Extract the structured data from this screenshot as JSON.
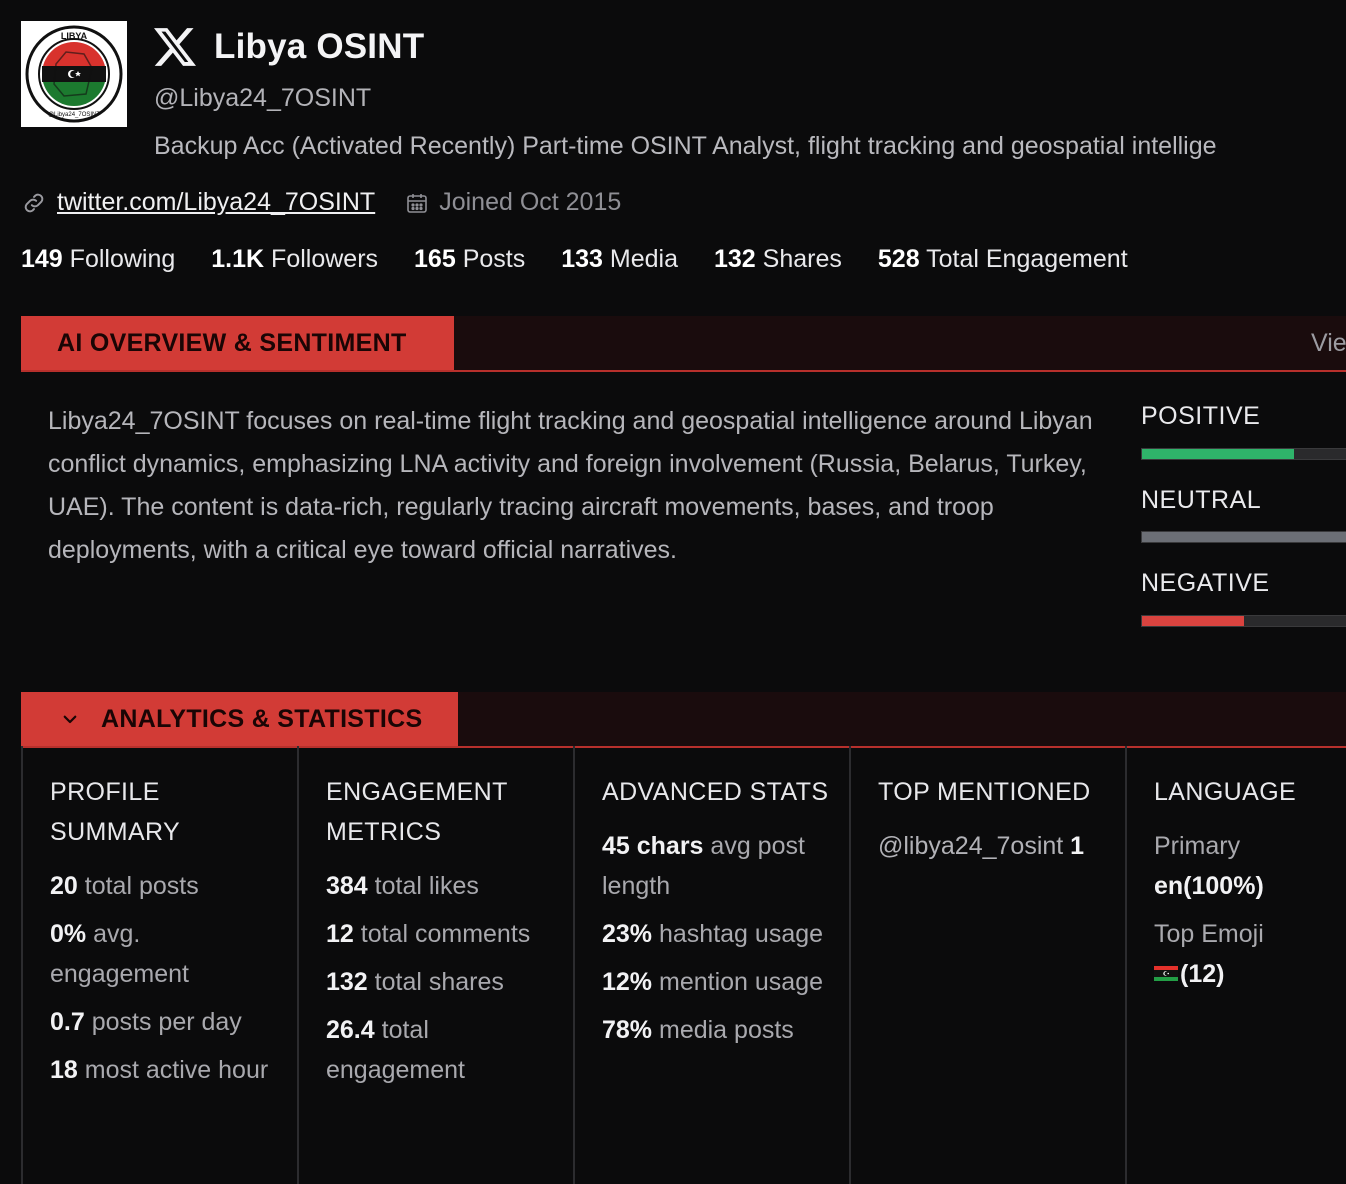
{
  "profile": {
    "name": "Libya OSINT",
    "handle": "@Libya24_7OSINT",
    "bio": "Backup Acc (Activated Recently) Part-time OSINT Analyst, flight tracking and geospatial intellige",
    "link": "twitter.com/Libya24_7OSINT",
    "joined": "Joined Oct 2015",
    "avatar_icon": "libya-osint-logo-icon",
    "avatar_text_top": "LIBYA",
    "avatar_text_bottom": "@Libya24_7OSINT"
  },
  "stats": [
    {
      "value": "149",
      "label": "Following"
    },
    {
      "value": "1.1K",
      "label": "Followers"
    },
    {
      "value": "165",
      "label": "Posts"
    },
    {
      "value": "133",
      "label": "Media"
    },
    {
      "value": "132",
      "label": "Shares"
    },
    {
      "value": "528",
      "label": "Total Engagement"
    }
  ],
  "overview": {
    "tab_label": "AI OVERVIEW & SENTIMENT",
    "view_label": "Vie",
    "text": "Libya24_7OSINT focuses on real-time flight tracking and geospatial intelligence around Libyan conflict dynamics, emphasizing LNA activity and foreign involvement (Russia, Belarus, Turkey, UAE). The content is data-rich, regularly tracing aircraft movements, bases, and troop deployments, with a critical eye toward official narratives.",
    "sentiment": [
      {
        "label": "POSITIVE",
        "fraction": 0.73,
        "color": "#2fb36a"
      },
      {
        "label": "NEUTRAL",
        "fraction": 1.0,
        "color": "#6c6f76"
      },
      {
        "label": "NEGATIVE",
        "fraction": 0.49,
        "color": "#d9433f"
      }
    ]
  },
  "analytics": {
    "tab_label": "ANALYTICS & STATISTICS",
    "columns": {
      "profile": {
        "title": "PROFILE SUMMARY",
        "items": [
          {
            "value": "20",
            "label": "total posts"
          },
          {
            "value": "0%",
            "label": "avg. engagement"
          },
          {
            "value": "0.7",
            "label": "posts per day"
          },
          {
            "value": "18",
            "label": "most active hour"
          }
        ]
      },
      "engagement": {
        "title": "ENGAGEMENT METRICS",
        "items": [
          {
            "value": "384",
            "label": "total likes"
          },
          {
            "value": "12",
            "label": "total comments"
          },
          {
            "value": "132",
            "label": "total shares"
          },
          {
            "value": "26.4",
            "label": "total engagement"
          }
        ]
      },
      "advanced": {
        "title": "ADVANCED STATS",
        "items": [
          {
            "value": "45 chars",
            "label": "avg post length"
          },
          {
            "value": "23%",
            "label": "hashtag usage"
          },
          {
            "value": "12%",
            "label": "mention usage"
          },
          {
            "value": "78%",
            "label": "media posts"
          }
        ]
      },
      "mentions": {
        "title": "TOP MENTIONED",
        "handle": "@libya24_7osint",
        "count": "1"
      },
      "language": {
        "title": "LANGUAGE",
        "primary_label": "Primary",
        "primary_value": "en(100%)",
        "emoji_label": "Top Emoji",
        "emoji_icon": "libya-flag-icon",
        "emoji_count": "(12)"
      }
    }
  }
}
